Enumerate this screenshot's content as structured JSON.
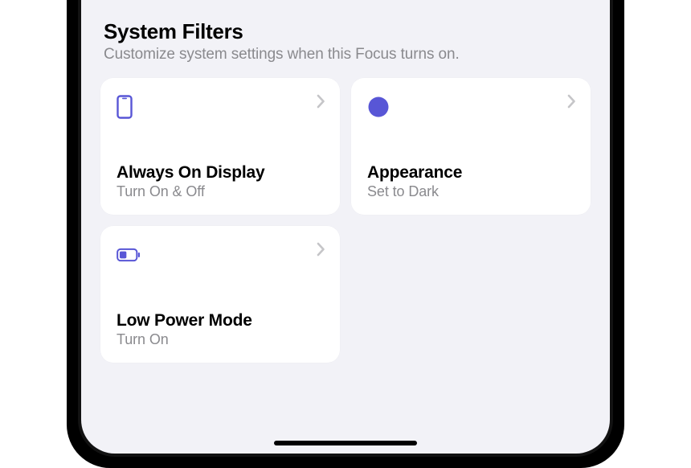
{
  "section": {
    "title": "System Filters",
    "subtitle": "Customize system settings when this Focus turns on."
  },
  "cards": {
    "aod": {
      "title": "Always On Display",
      "subtitle": "Turn On & Off"
    },
    "appearance": {
      "title": "Appearance",
      "subtitle": "Set to Dark"
    },
    "lowpower": {
      "title": "Low Power Mode",
      "subtitle": "Turn On"
    }
  },
  "colors": {
    "accent": "#5856d6"
  }
}
